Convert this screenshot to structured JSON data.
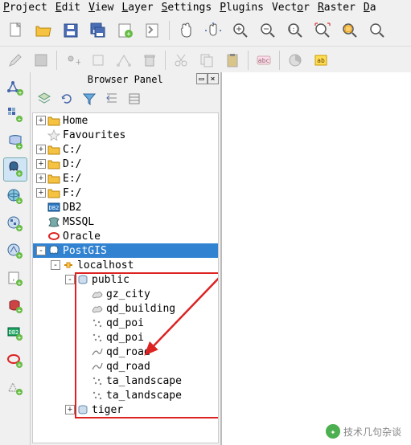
{
  "menu": {
    "items": [
      {
        "label": "Project",
        "u": 0
      },
      {
        "label": "Edit",
        "u": 0
      },
      {
        "label": "View",
        "u": 0
      },
      {
        "label": "Layer",
        "u": 0
      },
      {
        "label": "Settings",
        "u": 0
      },
      {
        "label": "Plugins",
        "u": 0
      },
      {
        "label": "Vector",
        "u": 4
      },
      {
        "label": "Raster",
        "u": 0
      },
      {
        "label": "Da",
        "u": 0
      }
    ]
  },
  "panel": {
    "title": "Browser Panel",
    "dock_label": "▭",
    "close_label": "×"
  },
  "tree": {
    "nodes": [
      {
        "depth": 0,
        "exp": "+",
        "icon": "folder",
        "label": "Home"
      },
      {
        "depth": 0,
        "exp": "",
        "icon": "star",
        "label": "Favourites"
      },
      {
        "depth": 0,
        "exp": "+",
        "icon": "folder",
        "label": "C:/"
      },
      {
        "depth": 0,
        "exp": "+",
        "icon": "folder",
        "label": "D:/"
      },
      {
        "depth": 0,
        "exp": "+",
        "icon": "folder",
        "label": "E:/"
      },
      {
        "depth": 0,
        "exp": "+",
        "icon": "folder",
        "label": "F:/"
      },
      {
        "depth": 0,
        "exp": "",
        "icon": "db2",
        "label": "DB2"
      },
      {
        "depth": 0,
        "exp": "",
        "icon": "mssql",
        "label": "MSSQL"
      },
      {
        "depth": 0,
        "exp": "",
        "icon": "oracle",
        "label": "Oracle"
      },
      {
        "depth": 0,
        "exp": "-",
        "icon": "postgis",
        "label": "PostGIS",
        "selected": true
      },
      {
        "depth": 1,
        "exp": "-",
        "icon": "conn",
        "label": "localhost"
      },
      {
        "depth": 2,
        "exp": "-",
        "icon": "schema",
        "label": "public"
      },
      {
        "depth": 3,
        "exp": "",
        "icon": "poly",
        "label": "gz_city"
      },
      {
        "depth": 3,
        "exp": "",
        "icon": "poly",
        "label": "qd_building"
      },
      {
        "depth": 3,
        "exp": "",
        "icon": "point",
        "label": "qd_poi"
      },
      {
        "depth": 3,
        "exp": "",
        "icon": "point",
        "label": "qd_poi"
      },
      {
        "depth": 3,
        "exp": "",
        "icon": "line",
        "label": "qd_road"
      },
      {
        "depth": 3,
        "exp": "",
        "icon": "line",
        "label": "qd_road"
      },
      {
        "depth": 3,
        "exp": "",
        "icon": "point",
        "label": "ta_landscape"
      },
      {
        "depth": 3,
        "exp": "",
        "icon": "point",
        "label": "ta_landscape"
      },
      {
        "depth": 2,
        "exp": "+",
        "icon": "schema",
        "label": "tiger"
      }
    ]
  },
  "watermark": {
    "text": "技术几句杂谈"
  }
}
